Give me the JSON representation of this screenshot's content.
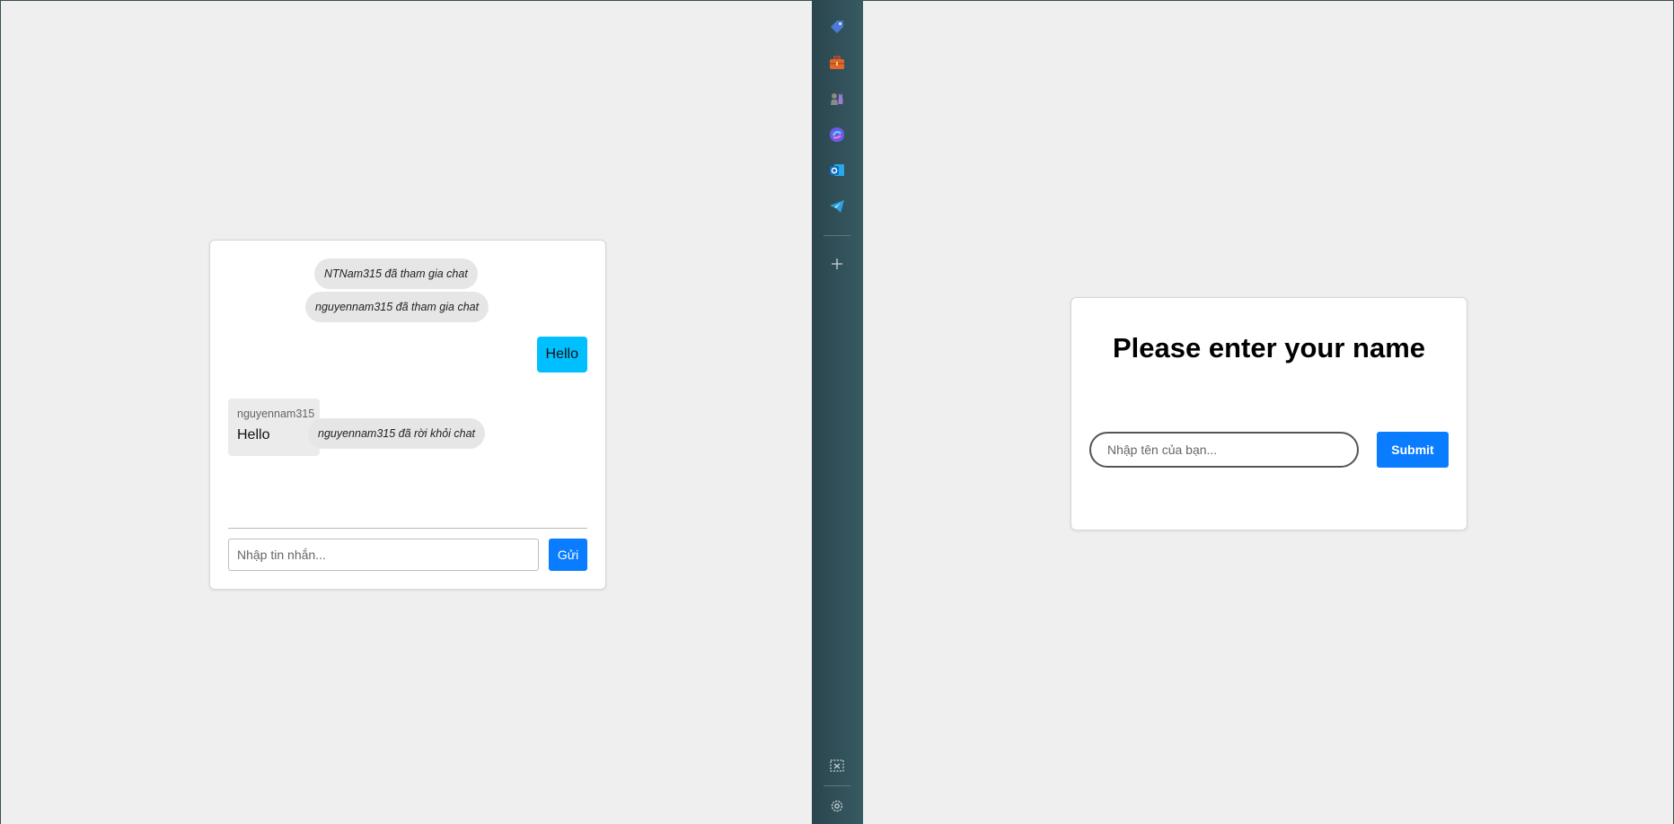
{
  "chat": {
    "messages": [
      {
        "type": "system",
        "text": "NTNam315 đã tham gia chat"
      },
      {
        "type": "system",
        "text": "nguyennam315 đã tham gia chat"
      },
      {
        "type": "sent",
        "text": "Hello"
      },
      {
        "type": "received",
        "sender": "nguyennam315",
        "text": "Hello"
      },
      {
        "type": "system",
        "text": "nguyennam315 đã rời khỏi chat"
      }
    ],
    "input_placeholder": "Nhập tin nhắn...",
    "send_label": "Gửi"
  },
  "sidebar": {
    "items": [
      {
        "icon": "tag-icon",
        "color": "#4a7bd6"
      },
      {
        "icon": "briefcase-icon",
        "color": "#e0662d"
      },
      {
        "icon": "chess-icon",
        "color": "#9b7ad8"
      },
      {
        "icon": "copilot-icon",
        "color": "#6b5be6"
      },
      {
        "icon": "outlook-icon",
        "color": "#1b7fd6"
      },
      {
        "icon": "telegram-icon",
        "color": "#2aa3e0"
      }
    ],
    "add_icon": "plus-icon",
    "bottom_items": [
      "screenshot-icon",
      "settings-icon"
    ]
  },
  "name_form": {
    "title": "Please enter your name",
    "input_placeholder": "Nhập tên của bạn...",
    "submit_label": "Submit"
  }
}
